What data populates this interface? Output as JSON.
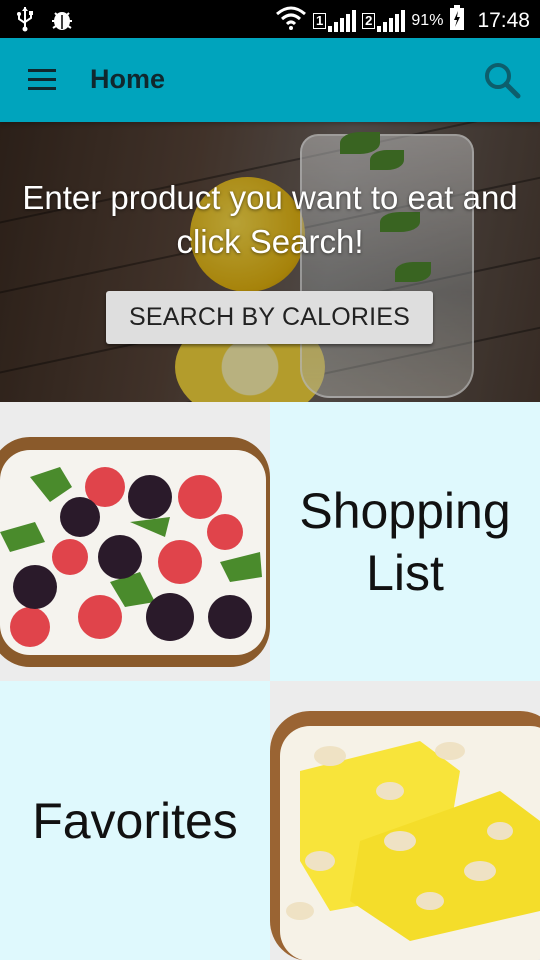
{
  "status_bar": {
    "sim1": "1",
    "sim2": "2",
    "battery": "91%",
    "time": "17:48",
    "icons": [
      "usb-icon",
      "bug-icon",
      "wifi-icon",
      "signal-icon",
      "battery-icon"
    ]
  },
  "app_bar": {
    "title": "Home",
    "menu_icon": "menu-icon",
    "search_icon": "search-icon",
    "color": "#00a4bd"
  },
  "hero": {
    "headline": "Enter product you want to eat and click Search!",
    "button_label": "SEARCH BY CALORIES"
  },
  "tiles": {
    "shopping_list": "Shopping List",
    "favorites": "Favorites",
    "tile_color": "#dff9fd"
  }
}
